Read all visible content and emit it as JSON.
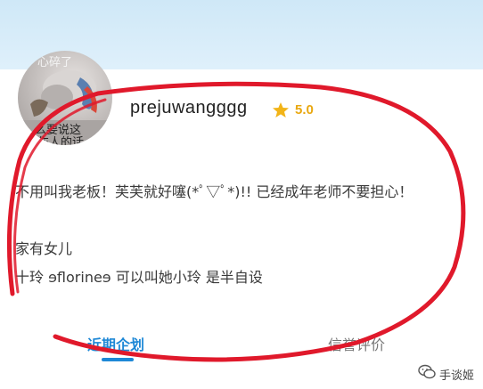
{
  "profile": {
    "avatar_text": [
      "心碎了",
      "，么要说这",
      "伤人的话"
    ],
    "username": "prejuwangggg",
    "rating": "5.0",
    "rating_icon": "star-icon",
    "bio": [
      "不用叫我老板！芙芙就好噻(*ﾟ▽ﾟ*)!! 已经成年老师不要担心！",
      "家有女儿",
      "十玲 ɘflorineɘ 可以叫她小玲 是半自设"
    ]
  },
  "tabs": [
    {
      "label": "近期企划",
      "active": true
    },
    {
      "label": "信誉评价",
      "active": false
    }
  ],
  "watermark": {
    "text": "手谈姬",
    "icon": "wechat-icon"
  },
  "colors": {
    "accent": "#1e88d6",
    "star": "#f2b418",
    "annotation": "#e0192b",
    "header_band": "#d6ecf9"
  }
}
